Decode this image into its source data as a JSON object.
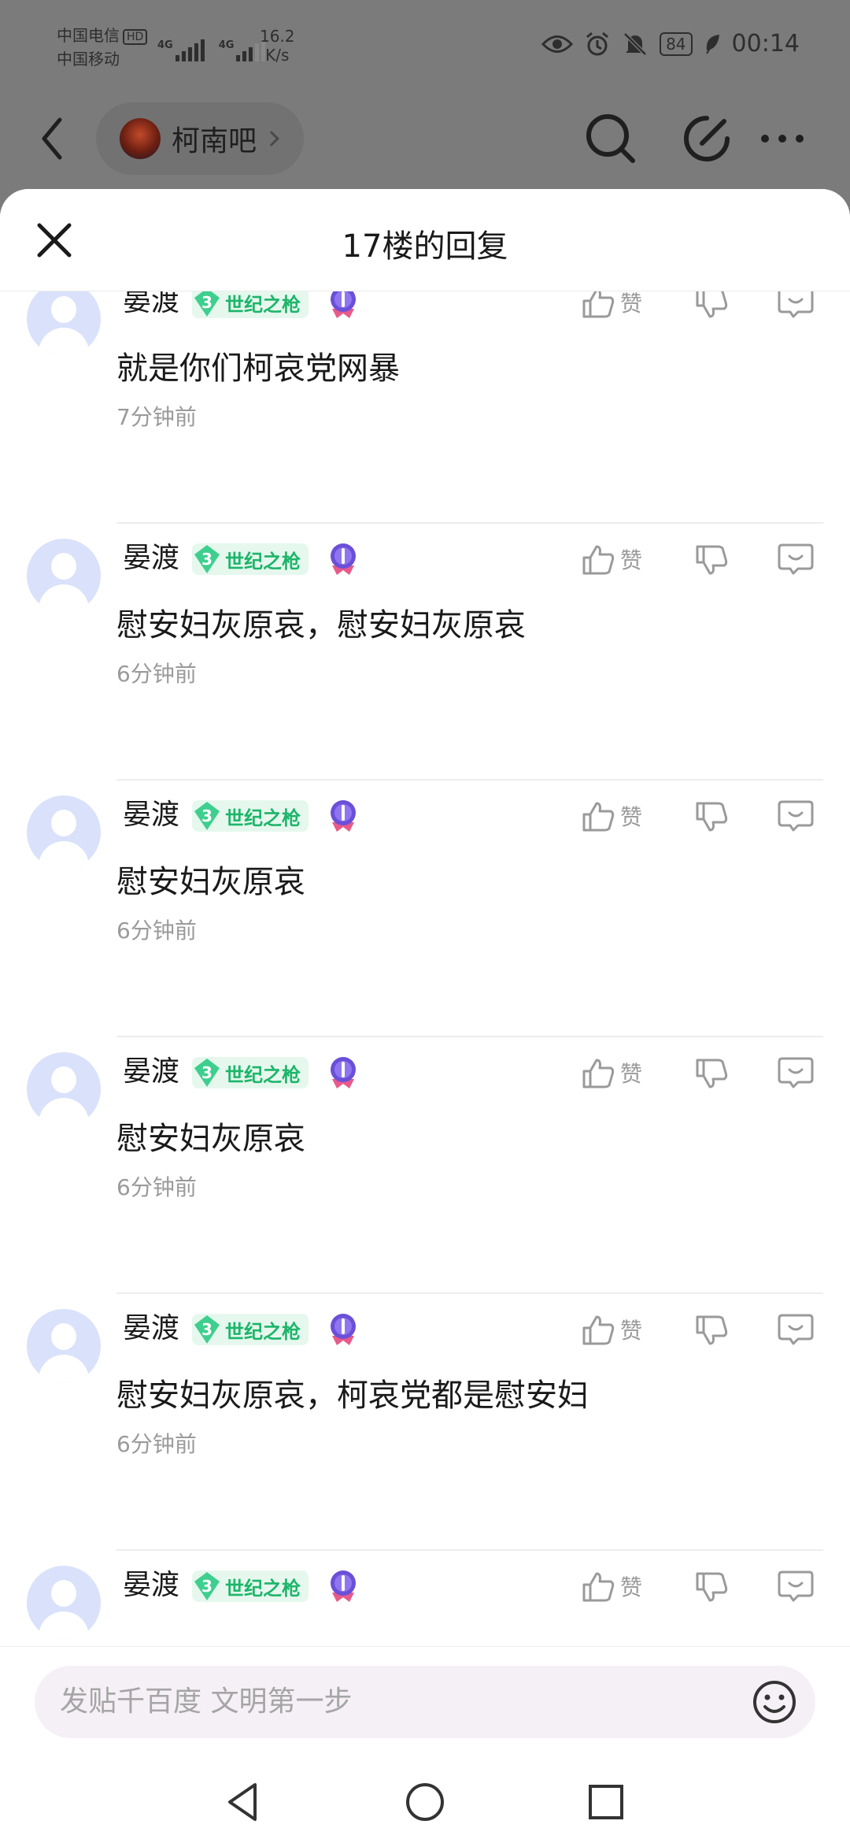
{
  "status_bar": {
    "carrier_1": "中国电信",
    "hd": "HD",
    "carrier_2": "中国移动",
    "net_1": "4G",
    "net_2": "4G",
    "speed_value": "16.2",
    "speed_unit": "K/s",
    "battery": "84",
    "time": "00:14",
    "icons": [
      "eye-icon",
      "alarm-icon",
      "mute-icon",
      "leaf-icon"
    ]
  },
  "top_nav": {
    "forum_name": "柯南吧",
    "icons": [
      "back-icon",
      "search-icon",
      "edit-icon",
      "more-icon"
    ]
  },
  "sheet": {
    "title": "17楼的回复"
  },
  "replies": [
    {
      "user": "晏渡",
      "level": "3",
      "badge_title": "世纪之枪",
      "content": "就是你们柯哀党网暴",
      "time": "7分钟前",
      "like_label": "赞"
    },
    {
      "user": "晏渡",
      "level": "3",
      "badge_title": "世纪之枪",
      "content": "慰安妇灰原哀，慰安妇灰原哀",
      "time": "6分钟前",
      "like_label": "赞"
    },
    {
      "user": "晏渡",
      "level": "3",
      "badge_title": "世纪之枪",
      "content": "慰安妇灰原哀",
      "time": "6分钟前",
      "like_label": "赞"
    },
    {
      "user": "晏渡",
      "level": "3",
      "badge_title": "世纪之枪",
      "content": "慰安妇灰原哀",
      "time": "6分钟前",
      "like_label": "赞"
    },
    {
      "user": "晏渡",
      "level": "3",
      "badge_title": "世纪之枪",
      "content": "慰安妇灰原哀，柯哀党都是慰安妇",
      "time": "6分钟前",
      "like_label": "赞"
    },
    {
      "user": "晏渡",
      "level": "3",
      "badge_title": "世纪之枪",
      "content": "",
      "time": "",
      "like_label": "赞"
    }
  ],
  "input": {
    "placeholder": "发贴千百度 文明第一步"
  },
  "colors": {
    "badge_green": "#1db56a",
    "avatar_bg": "#d9e1fb",
    "medal_purple": "#6b4fd8"
  }
}
